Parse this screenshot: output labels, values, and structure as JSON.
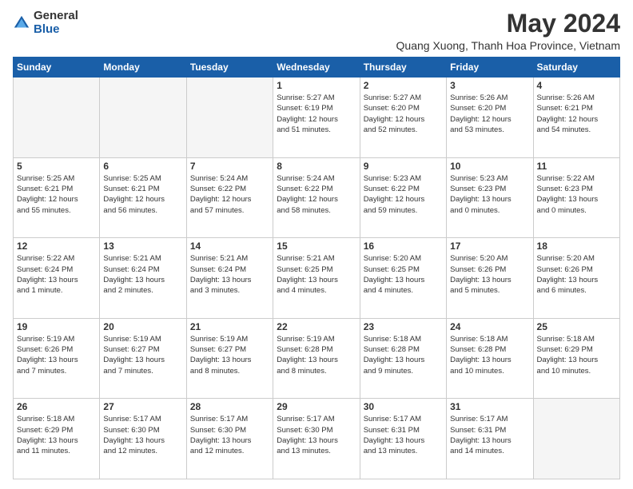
{
  "logo": {
    "general": "General",
    "blue": "Blue"
  },
  "header": {
    "title": "May 2024",
    "subtitle": "Quang Xuong, Thanh Hoa Province, Vietnam"
  },
  "days_of_week": [
    "Sunday",
    "Monday",
    "Tuesday",
    "Wednesday",
    "Thursday",
    "Friday",
    "Saturday"
  ],
  "weeks": [
    [
      {
        "day": "",
        "info": ""
      },
      {
        "day": "",
        "info": ""
      },
      {
        "day": "",
        "info": ""
      },
      {
        "day": "1",
        "info": "Sunrise: 5:27 AM\nSunset: 6:19 PM\nDaylight: 12 hours\nand 51 minutes."
      },
      {
        "day": "2",
        "info": "Sunrise: 5:27 AM\nSunset: 6:20 PM\nDaylight: 12 hours\nand 52 minutes."
      },
      {
        "day": "3",
        "info": "Sunrise: 5:26 AM\nSunset: 6:20 PM\nDaylight: 12 hours\nand 53 minutes."
      },
      {
        "day": "4",
        "info": "Sunrise: 5:26 AM\nSunset: 6:21 PM\nDaylight: 12 hours\nand 54 minutes."
      }
    ],
    [
      {
        "day": "5",
        "info": "Sunrise: 5:25 AM\nSunset: 6:21 PM\nDaylight: 12 hours\nand 55 minutes."
      },
      {
        "day": "6",
        "info": "Sunrise: 5:25 AM\nSunset: 6:21 PM\nDaylight: 12 hours\nand 56 minutes."
      },
      {
        "day": "7",
        "info": "Sunrise: 5:24 AM\nSunset: 6:22 PM\nDaylight: 12 hours\nand 57 minutes."
      },
      {
        "day": "8",
        "info": "Sunrise: 5:24 AM\nSunset: 6:22 PM\nDaylight: 12 hours\nand 58 minutes."
      },
      {
        "day": "9",
        "info": "Sunrise: 5:23 AM\nSunset: 6:22 PM\nDaylight: 12 hours\nand 59 minutes."
      },
      {
        "day": "10",
        "info": "Sunrise: 5:23 AM\nSunset: 6:23 PM\nDaylight: 13 hours\nand 0 minutes."
      },
      {
        "day": "11",
        "info": "Sunrise: 5:22 AM\nSunset: 6:23 PM\nDaylight: 13 hours\nand 0 minutes."
      }
    ],
    [
      {
        "day": "12",
        "info": "Sunrise: 5:22 AM\nSunset: 6:24 PM\nDaylight: 13 hours\nand 1 minute."
      },
      {
        "day": "13",
        "info": "Sunrise: 5:21 AM\nSunset: 6:24 PM\nDaylight: 13 hours\nand 2 minutes."
      },
      {
        "day": "14",
        "info": "Sunrise: 5:21 AM\nSunset: 6:24 PM\nDaylight: 13 hours\nand 3 minutes."
      },
      {
        "day": "15",
        "info": "Sunrise: 5:21 AM\nSunset: 6:25 PM\nDaylight: 13 hours\nand 4 minutes."
      },
      {
        "day": "16",
        "info": "Sunrise: 5:20 AM\nSunset: 6:25 PM\nDaylight: 13 hours\nand 4 minutes."
      },
      {
        "day": "17",
        "info": "Sunrise: 5:20 AM\nSunset: 6:26 PM\nDaylight: 13 hours\nand 5 minutes."
      },
      {
        "day": "18",
        "info": "Sunrise: 5:20 AM\nSunset: 6:26 PM\nDaylight: 13 hours\nand 6 minutes."
      }
    ],
    [
      {
        "day": "19",
        "info": "Sunrise: 5:19 AM\nSunset: 6:26 PM\nDaylight: 13 hours\nand 7 minutes."
      },
      {
        "day": "20",
        "info": "Sunrise: 5:19 AM\nSunset: 6:27 PM\nDaylight: 13 hours\nand 7 minutes."
      },
      {
        "day": "21",
        "info": "Sunrise: 5:19 AM\nSunset: 6:27 PM\nDaylight: 13 hours\nand 8 minutes."
      },
      {
        "day": "22",
        "info": "Sunrise: 5:19 AM\nSunset: 6:28 PM\nDaylight: 13 hours\nand 8 minutes."
      },
      {
        "day": "23",
        "info": "Sunrise: 5:18 AM\nSunset: 6:28 PM\nDaylight: 13 hours\nand 9 minutes."
      },
      {
        "day": "24",
        "info": "Sunrise: 5:18 AM\nSunset: 6:28 PM\nDaylight: 13 hours\nand 10 minutes."
      },
      {
        "day": "25",
        "info": "Sunrise: 5:18 AM\nSunset: 6:29 PM\nDaylight: 13 hours\nand 10 minutes."
      }
    ],
    [
      {
        "day": "26",
        "info": "Sunrise: 5:18 AM\nSunset: 6:29 PM\nDaylight: 13 hours\nand 11 minutes."
      },
      {
        "day": "27",
        "info": "Sunrise: 5:17 AM\nSunset: 6:30 PM\nDaylight: 13 hours\nand 12 minutes."
      },
      {
        "day": "28",
        "info": "Sunrise: 5:17 AM\nSunset: 6:30 PM\nDaylight: 13 hours\nand 12 minutes."
      },
      {
        "day": "29",
        "info": "Sunrise: 5:17 AM\nSunset: 6:30 PM\nDaylight: 13 hours\nand 13 minutes."
      },
      {
        "day": "30",
        "info": "Sunrise: 5:17 AM\nSunset: 6:31 PM\nDaylight: 13 hours\nand 13 minutes."
      },
      {
        "day": "31",
        "info": "Sunrise: 5:17 AM\nSunset: 6:31 PM\nDaylight: 13 hours\nand 14 minutes."
      },
      {
        "day": "",
        "info": ""
      }
    ]
  ]
}
